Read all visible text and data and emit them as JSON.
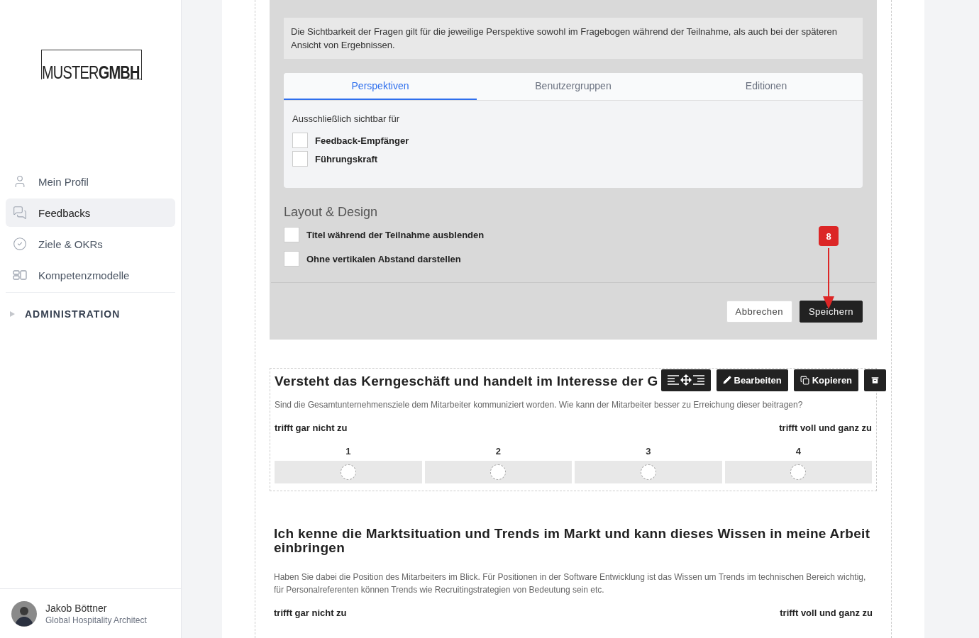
{
  "sidebar": {
    "logo": {
      "light": "MUSTER",
      "bold": "GMBH"
    },
    "nav": [
      {
        "label": "Mein Profil",
        "kind": "person",
        "selected": false
      },
      {
        "label": "Feedbacks",
        "kind": "chat",
        "selected": true
      },
      {
        "label": "Ziele & OKRs",
        "kind": "check",
        "selected": false
      },
      {
        "label": "Kompetenzmodelle",
        "kind": "grid",
        "selected": false
      }
    ],
    "section": {
      "label": "ADMINISTRATION",
      "expanded": false
    },
    "user": {
      "name": "Jakob Böttner",
      "role": "Global Hospitality Architect"
    }
  },
  "settings": {
    "notice": "Die Sichtbarkeit der Fragen gilt für die jeweilige Perspektive sowohl im Fragebogen während der Teilnahme, als auch bei der späteren Ansicht von Ergebnissen.",
    "tabs": [
      {
        "label": "Perspektiven",
        "selected": true
      },
      {
        "label": "Benutzergruppen",
        "selected": false
      },
      {
        "label": "Editionen",
        "selected": false
      }
    ],
    "tab_panel": {
      "caption": "Ausschließlich sichtbar für",
      "options": [
        {
          "label": "Feedback-Empfänger",
          "checked": false
        },
        {
          "label": "Führungskraft",
          "checked": false
        }
      ]
    },
    "layout": {
      "heading": "Layout & Design",
      "options": [
        {
          "label": "Titel während der Teilnahme ausblenden",
          "checked": false
        },
        {
          "label": "Ohne vertikalen Abstand darstellen",
          "checked": false
        }
      ]
    },
    "buttons": [
      {
        "label": "Abbrechen",
        "kind": "secondary"
      },
      {
        "label": "Speichern",
        "kind": "primary"
      }
    ],
    "annotation": {
      "label": "8"
    }
  },
  "questions": [
    {
      "title": "Versteht das Kerngeschäft und handelt im Interesse der G",
      "description": "Sind die Gesamtunternehmensziele dem Mitarbeiter kommuniziert worden. Wie kann der Mitarbeiter besser zu Erreichung dieser beitragen?",
      "low": "trifft gar nicht zu",
      "high": "trifft voll und ganz zu",
      "toolbar": [
        {
          "kind": "move"
        },
        {
          "kind": "edit",
          "label": "Bearbeiten"
        },
        {
          "kind": "copy",
          "label": "Kopieren"
        },
        {
          "kind": "archive"
        }
      ],
      "scale": [
        {
          "label": "1",
          "selected": false
        },
        {
          "label": "2",
          "selected": false
        },
        {
          "label": "3",
          "selected": false
        },
        {
          "label": "4",
          "selected": false
        }
      ]
    },
    {
      "title": "Ich kenne die Marktsituation und Trends im Markt und kann dieses Wissen in meine Arbeit einbringen",
      "description": "Haben Sie dabei die Position des Mitarbeiters im Blick. Für Positionen in der Software Entwicklung ist das Wissen um Trends im technischen Bereich wichtig, für Personalreferenten können Trends wie Recruitingstrategien von Bedeutung sein etc.",
      "low": "trifft gar nicht zu",
      "high": "trifft voll und ganz zu"
    }
  ]
}
